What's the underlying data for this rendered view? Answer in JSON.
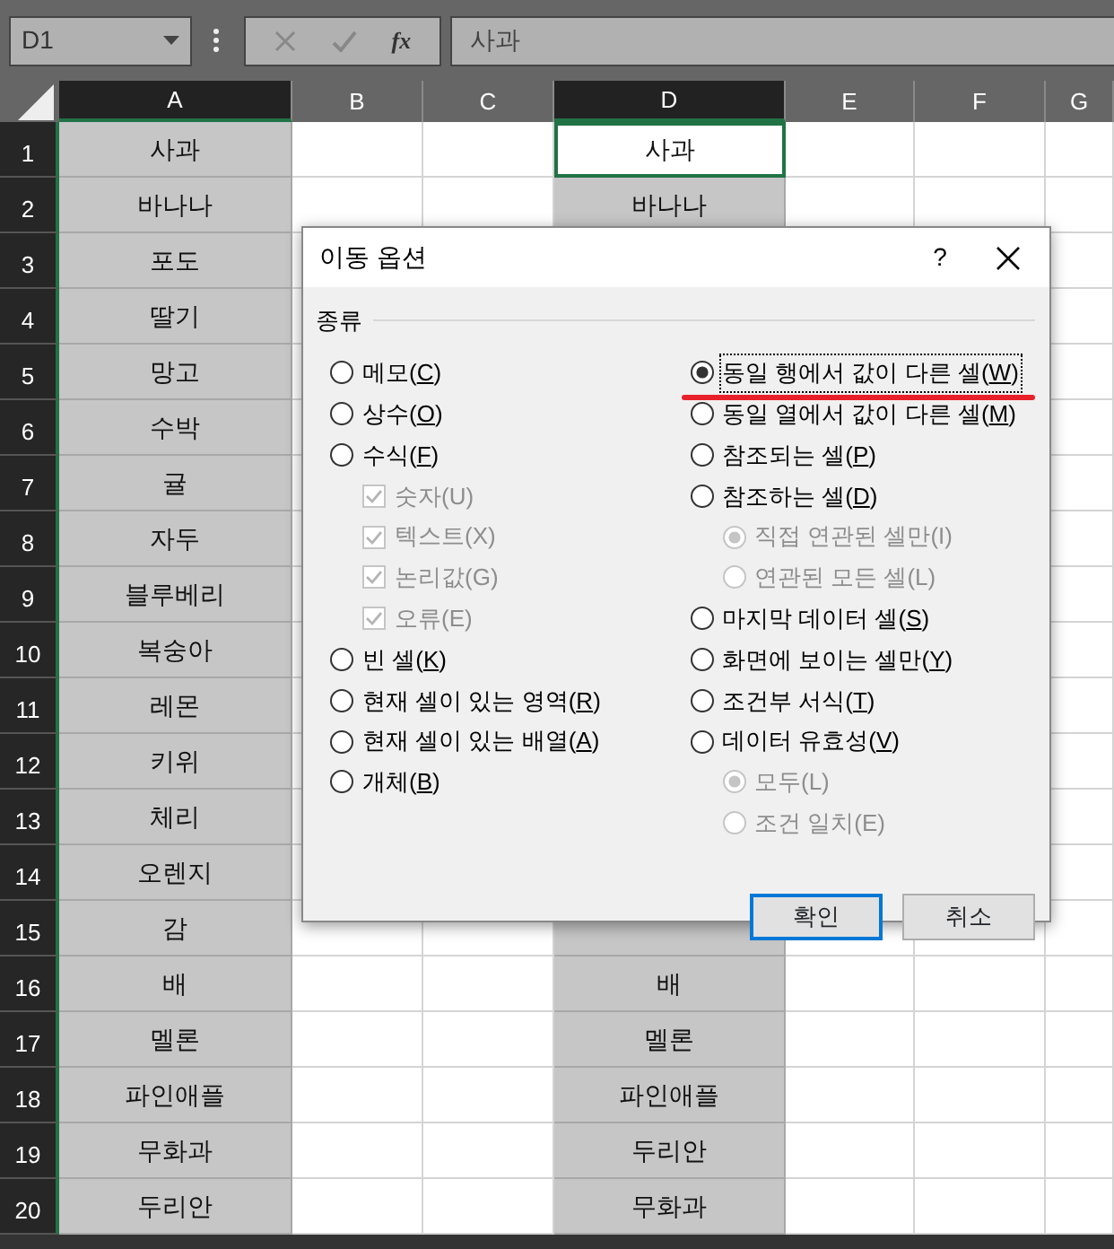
{
  "formula_bar": {
    "name_box": "D1",
    "function_label": "fx",
    "formula": "사과"
  },
  "columns": [
    {
      "label": "A",
      "selected": true
    },
    {
      "label": "B",
      "selected": false
    },
    {
      "label": "C",
      "selected": false
    },
    {
      "label": "D",
      "selected": true
    },
    {
      "label": "E",
      "selected": false
    },
    {
      "label": "F",
      "selected": false
    },
    {
      "label": "G",
      "selected": false
    }
  ],
  "rows": [
    {
      "number": "1",
      "cells": {
        "A": {
          "text": "사과",
          "active": false
        },
        "D": {
          "text": "사과",
          "active": true
        }
      }
    },
    {
      "number": "2",
      "cells": {
        "A": {
          "text": "바나나",
          "active": false
        },
        "D": {
          "text": "바나나",
          "active": false
        }
      }
    },
    {
      "number": "3",
      "cells": {
        "A": {
          "text": "포도",
          "active": false
        }
      }
    },
    {
      "number": "4",
      "cells": {
        "A": {
          "text": "딸기",
          "active": false
        }
      }
    },
    {
      "number": "5",
      "cells": {
        "A": {
          "text": "망고",
          "active": false
        }
      }
    },
    {
      "number": "6",
      "cells": {
        "A": {
          "text": "수박",
          "active": false
        }
      }
    },
    {
      "number": "7",
      "cells": {
        "A": {
          "text": "귤",
          "active": false
        }
      }
    },
    {
      "number": "8",
      "cells": {
        "A": {
          "text": "자두",
          "active": false
        }
      }
    },
    {
      "number": "9",
      "cells": {
        "A": {
          "text": "블루베리",
          "active": false
        }
      }
    },
    {
      "number": "10",
      "cells": {
        "A": {
          "text": "복숭아",
          "active": false
        }
      }
    },
    {
      "number": "11",
      "cells": {
        "A": {
          "text": "레몬",
          "active": false
        }
      }
    },
    {
      "number": "12",
      "cells": {
        "A": {
          "text": "키위",
          "active": false
        }
      }
    },
    {
      "number": "13",
      "cells": {
        "A": {
          "text": "체리",
          "active": false
        }
      }
    },
    {
      "number": "14",
      "cells": {
        "A": {
          "text": "오렌지",
          "active": false
        }
      }
    },
    {
      "number": "15",
      "cells": {
        "A": {
          "text": "감",
          "active": false
        }
      }
    },
    {
      "number": "16",
      "cells": {
        "A": {
          "text": "배",
          "active": false
        },
        "D": {
          "text": "배",
          "active": false
        }
      }
    },
    {
      "number": "17",
      "cells": {
        "A": {
          "text": "멜론",
          "active": false
        },
        "D": {
          "text": "멜론",
          "active": false
        }
      }
    },
    {
      "number": "18",
      "cells": {
        "A": {
          "text": "파인애플",
          "active": false
        },
        "D": {
          "text": "파인애플",
          "active": false
        }
      }
    },
    {
      "number": "19",
      "cells": {
        "A": {
          "text": "무화과",
          "active": false
        },
        "D": {
          "text": "두리안",
          "active": false
        }
      }
    },
    {
      "number": "20",
      "cells": {
        "A": {
          "text": "두리안",
          "active": false
        },
        "D": {
          "text": "무화과",
          "active": false
        }
      }
    }
  ],
  "dialog": {
    "title": "이동 옵션",
    "help": "?",
    "group_label": "종류",
    "left_options": [
      {
        "kind": "radio",
        "label": "메모(C)",
        "selected": false,
        "disabled": false
      },
      {
        "kind": "radio",
        "label": "상수(O)",
        "selected": false,
        "disabled": false
      },
      {
        "kind": "radio",
        "label": "수식(F)",
        "selected": false,
        "disabled": false,
        "children": [
          {
            "kind": "checkbox",
            "label": "숫자(U)",
            "checked": true,
            "disabled": true
          },
          {
            "kind": "checkbox",
            "label": "텍스트(X)",
            "checked": true,
            "disabled": true
          },
          {
            "kind": "checkbox",
            "label": "논리값(G)",
            "checked": true,
            "disabled": true
          },
          {
            "kind": "checkbox",
            "label": "오류(E)",
            "checked": true,
            "disabled": true
          }
        ]
      },
      {
        "kind": "radio",
        "label": "빈 셀(K)",
        "selected": false,
        "disabled": false
      },
      {
        "kind": "radio",
        "label": "현재 셀이 있는 영역(R)",
        "selected": false,
        "disabled": false
      },
      {
        "kind": "radio",
        "label": "현재 셀이 있는 배열(A)",
        "selected": false,
        "disabled": false
      },
      {
        "kind": "radio",
        "label": "개체(B)",
        "selected": false,
        "disabled": false
      }
    ],
    "right_options": [
      {
        "kind": "radio",
        "label": "동일 행에서 값이 다른 셀(W)",
        "selected": true,
        "disabled": false,
        "annotated": true
      },
      {
        "kind": "radio",
        "label": "동일 열에서 값이 다른 셀(M)",
        "selected": false,
        "disabled": false
      },
      {
        "kind": "radio",
        "label": "참조되는 셀(P)",
        "selected": false,
        "disabled": false
      },
      {
        "kind": "radio",
        "label": "참조하는 셀(D)",
        "selected": false,
        "disabled": false,
        "children": [
          {
            "kind": "radio",
            "label": "직접 연관된 셀만(I)",
            "selected": true,
            "disabled": true
          },
          {
            "kind": "radio",
            "label": "연관된 모든 셀(L)",
            "selected": false,
            "disabled": true
          }
        ]
      },
      {
        "kind": "radio",
        "label": "마지막 데이터 셀(S)",
        "selected": false,
        "disabled": false
      },
      {
        "kind": "radio",
        "label": "화면에 보이는 셀만(Y)",
        "selected": false,
        "disabled": false
      },
      {
        "kind": "radio",
        "label": "조건부 서식(T)",
        "selected": false,
        "disabled": false
      },
      {
        "kind": "radio",
        "label": "데이터 유효성(V)",
        "selected": false,
        "disabled": false,
        "children": [
          {
            "kind": "radio",
            "label": "모두(L)",
            "selected": true,
            "disabled": true
          },
          {
            "kind": "radio",
            "label": "조건 일치(E)",
            "selected": false,
            "disabled": true
          }
        ]
      }
    ],
    "buttons": [
      {
        "label": "확인",
        "default": true
      },
      {
        "label": "취소",
        "default": false
      }
    ]
  }
}
